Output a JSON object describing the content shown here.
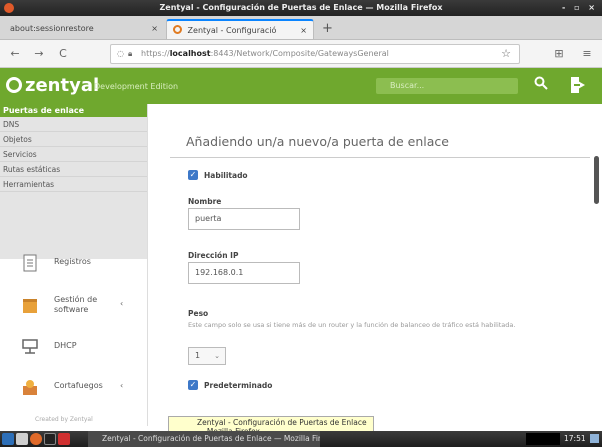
{
  "window": {
    "title": "Zentyal - Configuración de Puertas de Enlace — Mozilla Firefox",
    "controls": "- ▫ ×"
  },
  "tabs": [
    {
      "label": "about:sessionrestore",
      "close": "×"
    },
    {
      "label": "Zentyal - Configuració",
      "close": "×",
      "active": true
    }
  ],
  "new_tab": "+",
  "nav": {
    "back": "←",
    "forward": "→",
    "reload": "C",
    "url_prefix": "https://",
    "url_host": "localhost",
    "url_path": ":8443/Network/Composite/GatewaysGeneral",
    "star": "☆",
    "library": "⊞",
    "menu": "≡"
  },
  "header": {
    "logo": "zentyal",
    "edition": "Development Edition",
    "search_placeholder": "Buscar...",
    "brand_color": "#6fa82e"
  },
  "sidebar": {
    "section_title": "Puertas de enlace",
    "sub_items": [
      "DNS",
      "Objetos",
      "Servicios",
      "Rutas estáticas",
      "Herramientas"
    ],
    "menu": [
      {
        "label": "Registros",
        "icon": "document-icon",
        "arrow": ""
      },
      {
        "label": "Gestión de software",
        "icon": "package-icon",
        "arrow": "‹"
      },
      {
        "label": "DHCP",
        "icon": "network-icon",
        "arrow": ""
      },
      {
        "label": "Cortafuegos",
        "icon": "firewall-icon",
        "arrow": "‹"
      }
    ],
    "powered_by": "Created by Zentyal"
  },
  "form": {
    "title": "Añadiendo un/a nuevo/a puerta de enlace",
    "enabled_label": "Habilitado",
    "name_label": "Nombre",
    "name_value": "puerta",
    "ip_label": "Dirección IP",
    "ip_value": "192.168.0.1",
    "weight_label": "Peso",
    "weight_desc": "Este campo solo se usa si tiene más de un router y la función de balanceo de tráfico está habilitada.",
    "weight_value": "1",
    "default_label": "Predeterminado"
  },
  "tooltip": "Zentyal - Configuración de Puertas de Enlace — Mozilla Firefox",
  "taskbar": {
    "task_label": "Zentyal - Configuración de Puertas de Enlace — Mozilla Firefox",
    "clock": "17:51"
  }
}
